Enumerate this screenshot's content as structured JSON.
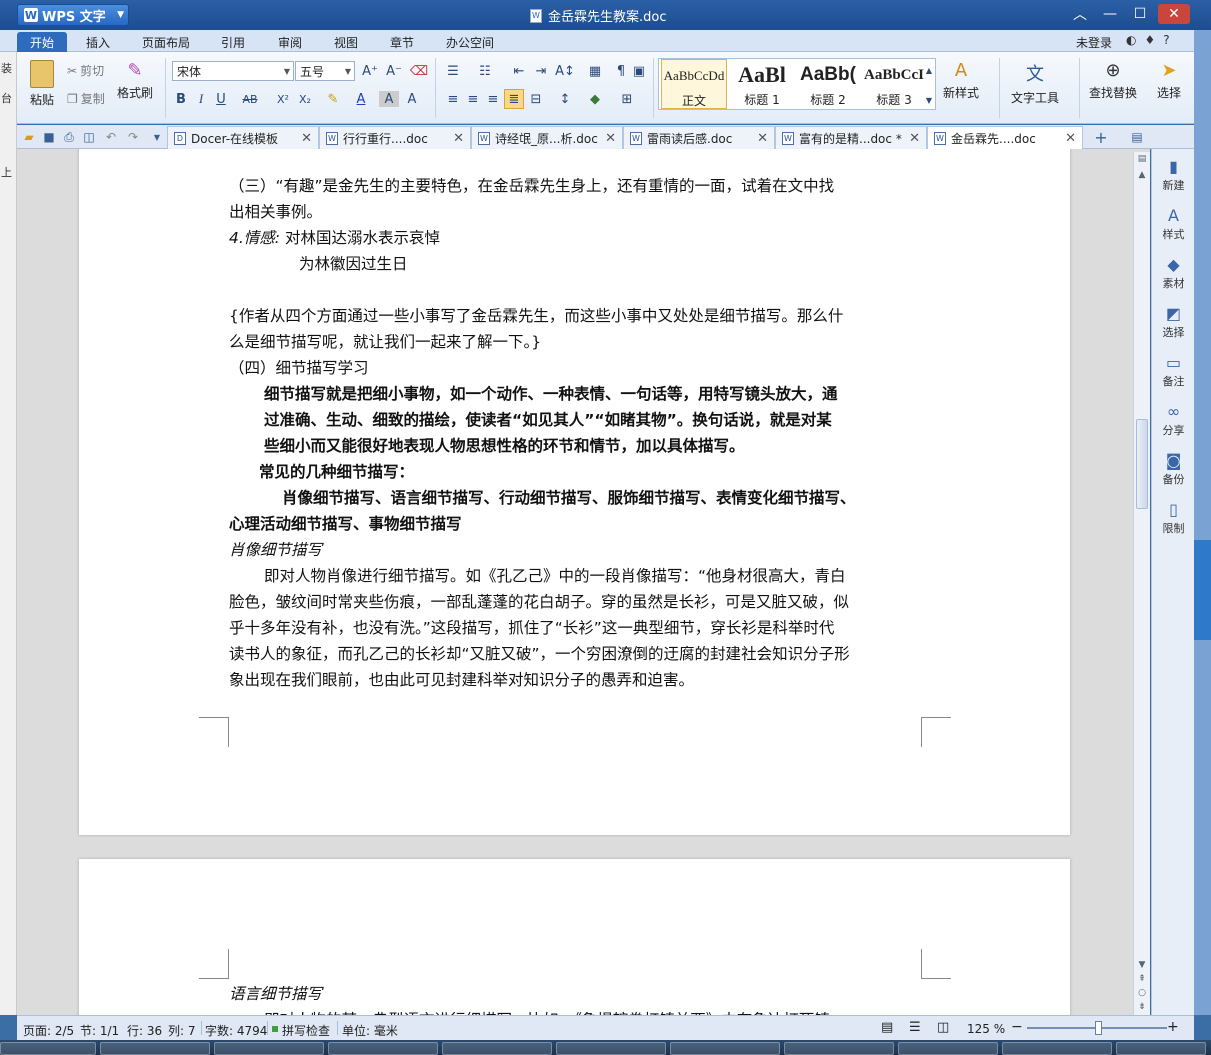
{
  "app": {
    "menu_label": "WPS 文字",
    "doc_title": "金岳霖先生教案.doc"
  },
  "menu_tabs": [
    "开始",
    "插入",
    "页面布局",
    "引用",
    "审阅",
    "视图",
    "章节",
    "办公空间"
  ],
  "login": "未登录",
  "ribbon": {
    "paste": "粘贴",
    "cut": "剪切",
    "copy": "复制",
    "format_painter": "格式刷",
    "font_name": "宋体",
    "font_size": "五号",
    "styles": [
      {
        "sample": "AaBbCcDd",
        "label": "正文"
      },
      {
        "sample": "AaBl",
        "label": "标题 1"
      },
      {
        "sample": "AaBb(",
        "label": "标题 2"
      },
      {
        "sample": "AaBbCcI",
        "label": "标题 3"
      }
    ],
    "new_style": "新样式",
    "text_tools": "文字工具",
    "find_replace": "查找替换",
    "select": "选择"
  },
  "tabs": [
    {
      "label": "Docer-在线模板",
      "icon": "D"
    },
    {
      "label": "行行重行....doc",
      "icon": "W"
    },
    {
      "label": "诗经氓_原...析.doc",
      "icon": "W"
    },
    {
      "label": "雷雨读后感.doc",
      "icon": "W"
    },
    {
      "label": "富有的是精...doc *",
      "icon": "W"
    },
    {
      "label": "金岳霖先....doc",
      "icon": "W"
    }
  ],
  "doc": {
    "p1a": "（三）“有趣”是金先生的主要特色，在金岳霖先生身上，还有重情的一面，试着在文中找",
    "p1b": "出相关事例。",
    "p2_label": "4.情感:",
    "p2_text": "对林国达溺水表示哀悼",
    "p2b": "为林徽因过生日",
    "p3a": "{作者从四个方面通过一些小事写了金岳霖先生，而这些小事中又处处是细节描写。那么什",
    "p3b": "么是细节描写呢，就让我们一起来了解一下。}",
    "p4": "（四）细节描写学习",
    "p5a": "细节描写就是把细小事物，如一个动作、一种表情、一句话等，用特写镜头放大，通",
    "p5b": "过准确、生动、细致的描绘，使读者“如见其人”“如睹其物”。换句话说，就是对某",
    "p5c": "些细小而又能很好地表现人物思想性格的环节和情节，加以具体描写。",
    "p6": "常见的几种细节描写：",
    "p7a": "肖像细节描写、语言细节描写、行动细节描写、服饰细节描写、表情变化细节描写、",
    "p7b": "心理活动细节描写、事物细节描写",
    "p8": "肖像细节描写",
    "p9a": "即对人物肖像进行细节描写。如《孔乙己》中的一段肖像描写：“他身材很高大，青白",
    "p9b": "脸色，皱纹间时常夹些伤痕，一部乱蓬蓬的花白胡子。穿的虽然是长衫，可是又脏又破，似",
    "p9c": "乎十多年没有补，也没有洗。”这段描写，抓住了“长衫”这一典型细节，穿长衫是科举时代",
    "p9d": "读书人的象征，而孔乙己的长衫却“又脏又破”，一个穷困潦倒的迂腐的封建社会知识分子形",
    "p9e": "象出现在我们眼前，也由此可见封建科举对知识分子的愚弄和迫害。",
    "p10": "语言细节描写",
    "p11": "即对人物的某一典型语言进行细描写。比如，《鲁提辖拳打镇关西》中有鲁达打死镇"
  },
  "taskpane": [
    "新建",
    "样式",
    "素材",
    "选择",
    "备注",
    "分享",
    "备份",
    "限制"
  ],
  "status": {
    "page": "页面: 2/5",
    "section": "节: 1/1",
    "row": "行: 36",
    "col": "列: 7",
    "wordcount": "字数: 4794",
    "spellcheck": "拼写检查",
    "unit": "单位: 毫米",
    "zoom": "125 %"
  },
  "leftstrip": [
    "装",
    "台",
    "上"
  ]
}
